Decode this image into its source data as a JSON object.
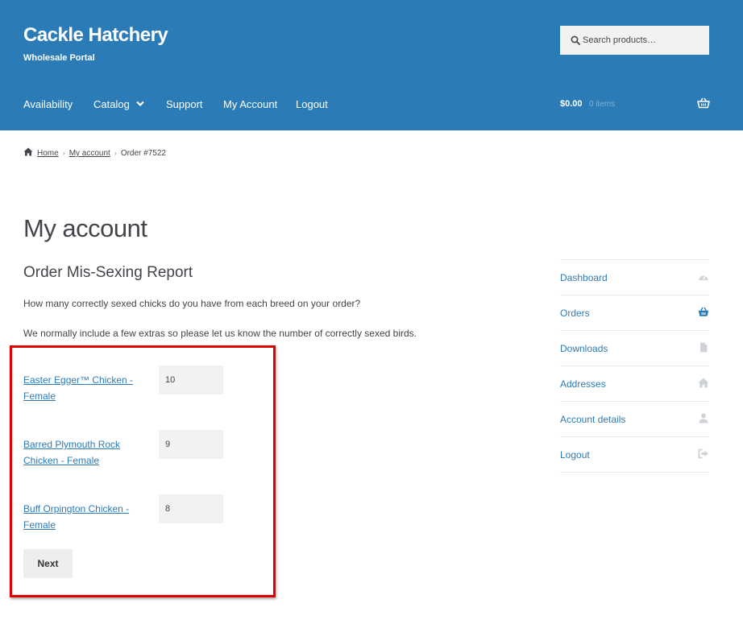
{
  "site": {
    "title": "Cackle Hatchery",
    "description": "Wholesale Portal"
  },
  "search": {
    "placeholder": "Search products…"
  },
  "nav": {
    "items": [
      "Availability",
      "Catalog",
      "Support",
      "My Account",
      "Logout"
    ]
  },
  "cart": {
    "total": "$0.00",
    "count": "0 items"
  },
  "breadcrumb": {
    "home": "Home",
    "account": "My account",
    "current": "Order #7522"
  },
  "page": {
    "title": "My account",
    "section_title": "Order Mis-Sexing Report",
    "question": "How many correctly sexed chicks do you have from each breed on your order?",
    "note": "We normally include a few extras so please let us know the number of correctly sexed birds."
  },
  "breeds": [
    {
      "line1": "Easter Egger™ Chicken -",
      "line2": "Female",
      "qty": "10"
    },
    {
      "line1": "Barred Plymouth Rock",
      "line2": "Chicken - Female",
      "qty": "9"
    },
    {
      "line1": "Buff Orpington Chicken -",
      "line2": "Female",
      "qty": "8"
    }
  ],
  "form": {
    "next_label": "Next"
  },
  "sidebar": {
    "items": [
      {
        "label": "Dashboard",
        "icon": "dashboard-icon"
      },
      {
        "label": "Orders",
        "icon": "basket-icon"
      },
      {
        "label": "Downloads",
        "icon": "file-icon"
      },
      {
        "label": "Addresses",
        "icon": "home-icon"
      },
      {
        "label": "Account details",
        "icon": "user-icon"
      },
      {
        "label": "Logout",
        "icon": "logout-icon"
      }
    ]
  },
  "colors": {
    "header": "#2b7cb6",
    "link": "#2c7bb6",
    "highlight": "#e10000"
  }
}
